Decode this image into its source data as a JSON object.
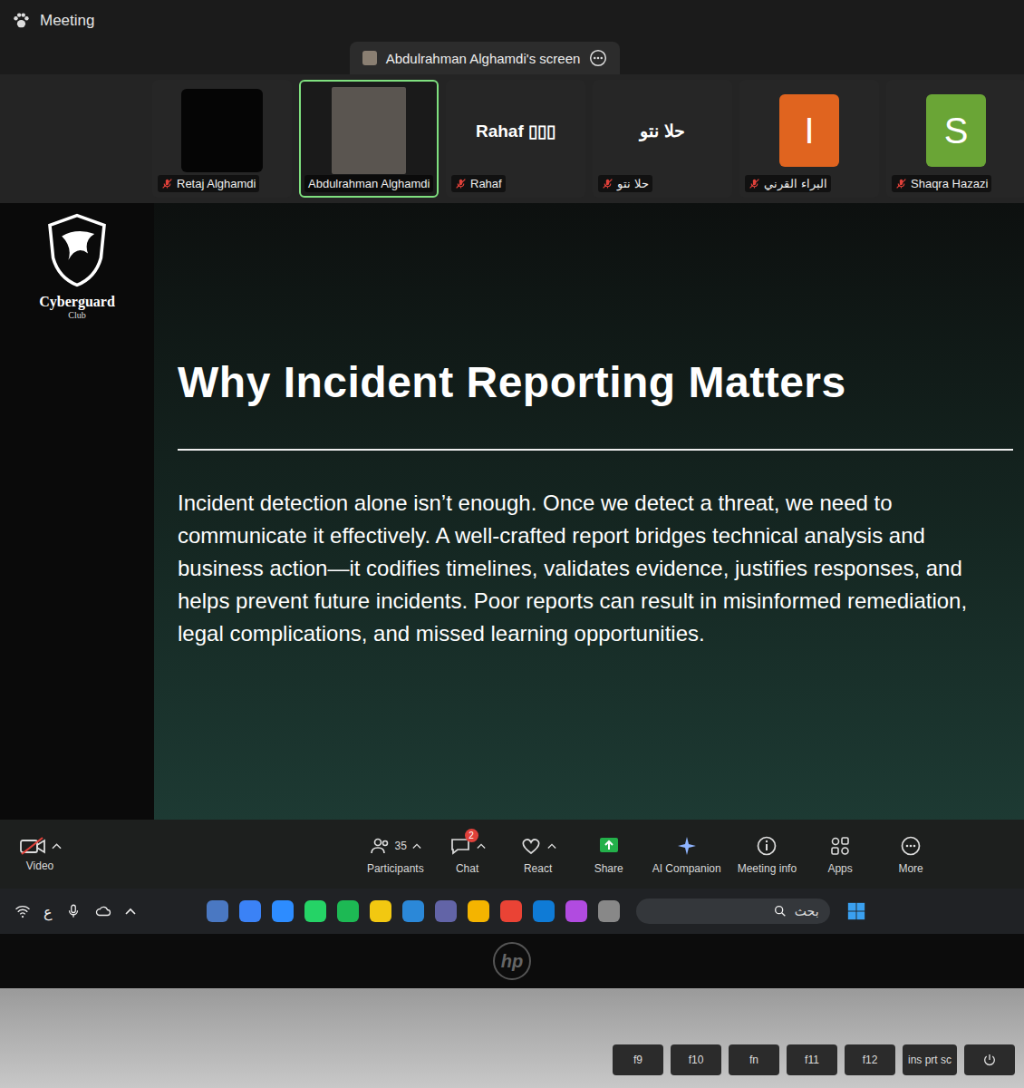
{
  "window": {
    "title": "Meeting"
  },
  "share_banner": {
    "label": "Abdulrahman Alghamdi's screen"
  },
  "participants": [
    {
      "name": "Retaj Alghamdi",
      "kind": "blank",
      "muted": true,
      "selected": false
    },
    {
      "name": "Abdulrahman Alghamdi",
      "kind": "video",
      "muted": false,
      "selected": true
    },
    {
      "name": "Rahaf",
      "display": "Rahaf ▯▯▯",
      "kind": "name",
      "muted": true,
      "selected": false
    },
    {
      "name": "حلا نتو",
      "display": "حلا نتو",
      "kind": "name",
      "muted": true,
      "selected": false
    },
    {
      "name": "البراء القرني",
      "initial": "I",
      "kind": "avatar",
      "color": "#e0641f",
      "muted": true,
      "selected": false
    },
    {
      "name": "Shaqra Hazazi",
      "initial": "S",
      "kind": "avatar",
      "color": "#6aa536",
      "muted": true,
      "selected": false
    }
  ],
  "slide": {
    "logo": {
      "name": "Cyberguard",
      "sub": "Club"
    },
    "title": "Why Incident Reporting Matters",
    "body": "Incident detection alone isn’t enough. Once we detect a threat, we need to communicate it effectively. A well-crafted report bridges technical analysis and business action—it codifies timelines, validates evidence, justifies responses, and helps prevent future incidents. Poor reports can result in misinformed remediation, legal complications, and missed learning opportunities."
  },
  "toolbar": {
    "video": {
      "label": "Video",
      "off": true
    },
    "items": [
      {
        "label": "Participants",
        "count": "35",
        "has_menu": true
      },
      {
        "label": "Chat",
        "badge": "2",
        "has_menu": true
      },
      {
        "label": "React",
        "has_menu": true
      },
      {
        "label": "Share",
        "has_menu": false
      },
      {
        "label": "AI Companion",
        "has_menu": false
      },
      {
        "label": "Meeting info",
        "has_menu": false
      },
      {
        "label": "Apps",
        "has_menu": false
      },
      {
        "label": "More",
        "has_menu": false
      }
    ]
  },
  "taskbar": {
    "language": "ع",
    "search": {
      "placeholder": "بحث"
    }
  },
  "device": {
    "brand": "hp",
    "keys": [
      "f9",
      "f10",
      "fn",
      "f11",
      "f12",
      "ins prt sc"
    ]
  }
}
